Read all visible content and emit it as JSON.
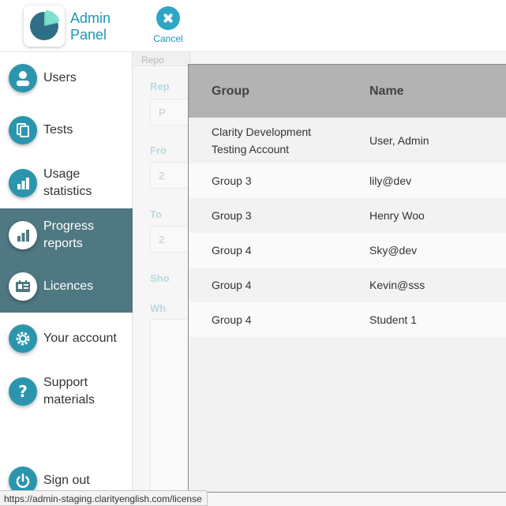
{
  "header": {
    "brand_line1": "Admin",
    "brand_line2": "Panel",
    "cancel_label": "Cancel",
    "logo_icon": "pie-chart-logo-icon"
  },
  "sidebar": {
    "items": [
      {
        "label": "Users",
        "icon": "user-icon"
      },
      {
        "label": "Tests",
        "icon": "document-icon"
      },
      {
        "label_line1": "Usage",
        "label_line2": "statistics",
        "icon": "bar-chart-icon"
      },
      {
        "label_line1": "Progress",
        "label_line2": "reports",
        "icon": "bar-chart-icon",
        "active": true
      },
      {
        "label": "Licences",
        "icon": "id-card-icon",
        "active": true
      },
      {
        "label": "Your account",
        "icon": "gear-icon"
      },
      {
        "label_line1": "Support",
        "label_line2": "materials",
        "icon": "question-icon"
      },
      {
        "label": "Sign out",
        "icon": "power-icon"
      }
    ],
    "active_color": "#4f7882",
    "icon_color": "#2b95ae"
  },
  "background_form": {
    "tab_label": "Repo",
    "labels": [
      "Rep",
      "Fro",
      "To",
      "Sho",
      "Wh"
    ],
    "fields": [
      "P",
      "2",
      "2"
    ]
  },
  "modal": {
    "columns": [
      "Group",
      "Name"
    ],
    "rows": [
      {
        "group_line1": "Clarity Development",
        "group_line2": "Testing Account",
        "name": "User, Admin"
      },
      {
        "group": "Group 3",
        "name": "lily@dev"
      },
      {
        "group": "Group 3",
        "name": "Henry Woo"
      },
      {
        "group": "Group 4",
        "name": "Sky@dev"
      },
      {
        "group": "Group 4",
        "name": "Kevin@sss"
      },
      {
        "group": "Group 4",
        "name": "Student 1"
      }
    ]
  },
  "status_bar": {
    "url": "https://admin-staging.clarityenglish.com/license"
  },
  "colors": {
    "accent": "#1b96b7",
    "table_header": "#b3b3b3"
  }
}
